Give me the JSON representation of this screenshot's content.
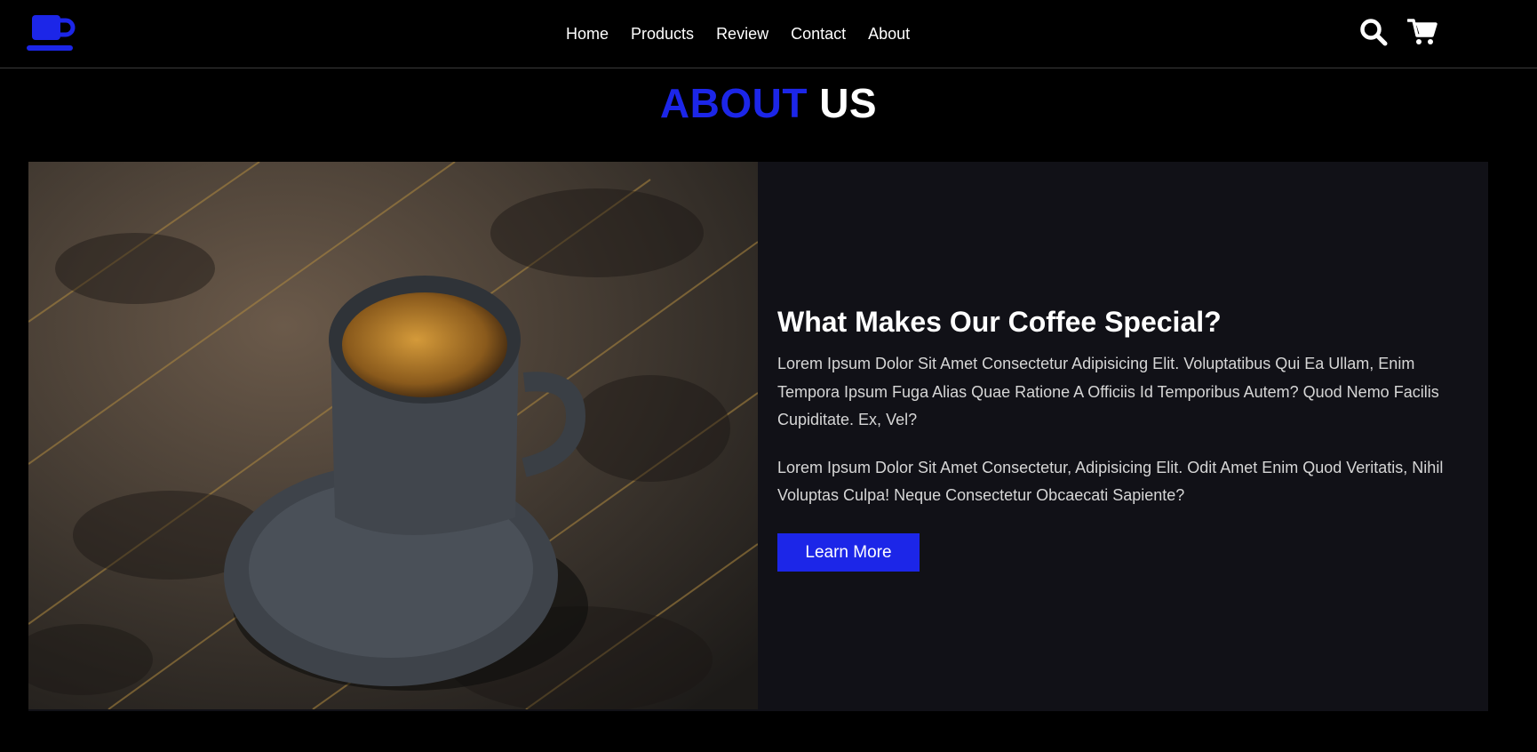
{
  "header": {
    "nav": [
      "Home",
      "Products",
      "Review",
      "Contact",
      "About"
    ],
    "icons": [
      "search-icon",
      "cart-icon"
    ],
    "logo_icon": "coffee-cup-icon"
  },
  "section": {
    "title_accent": "ABOUT",
    "title_rest": "US"
  },
  "about": {
    "image": "coffee-cup-on-wooden-table",
    "heading": "What Makes Our Coffee Special?",
    "paragraph1": "Lorem Ipsum Dolor Sit Amet Consectetur Adipisicing Elit. Voluptatibus Qui Ea Ullam, Enim Tempora Ipsum Fuga Alias Quae Ratione A Officiis Id Temporibus Autem? Quod Nemo Facilis Cupiditate. Ex, Vel?",
    "paragraph2": "Lorem Ipsum Dolor Sit Amet Consectetur, Adipisicing Elit. Odit Amet Enim Quod Veritatis, Nihil Voluptas Culpa! Neque Consectetur Obcaecati Sapiente?",
    "button_label": "Learn More"
  },
  "colors": {
    "accent": "#1c26e8",
    "background": "#000000",
    "card": "#111117"
  }
}
